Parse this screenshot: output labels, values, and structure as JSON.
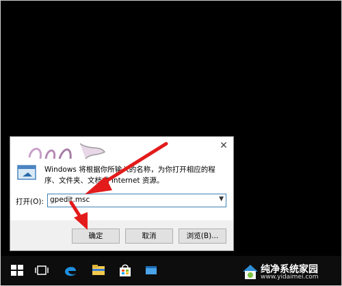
{
  "dialog": {
    "description": "Windows 将根据你所输入的名称，为你打开相应的程序、文件夹、文档或 Internet 资源。",
    "open_label": "打开(O):",
    "open_value": "gpedit.msc",
    "ok_label": "确定",
    "cancel_label": "取消",
    "browse_label": "浏览(B)...",
    "close_glyph": "✕"
  },
  "watermark": {
    "site_name": "纯净系统家园",
    "site_url": "www.yidaimei.com"
  },
  "colors": {
    "arrow": "#e31b1b",
    "combo_border": "#3c7fb1",
    "button_bg": "#e1e1e1",
    "taskbar_bg": "#0d0d0d"
  }
}
